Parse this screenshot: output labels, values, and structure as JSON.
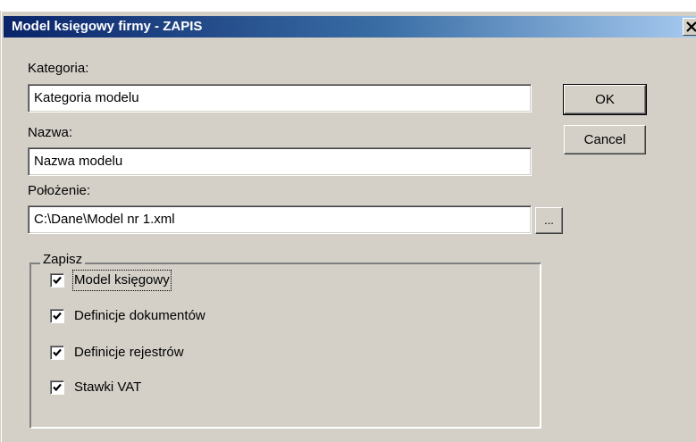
{
  "window": {
    "title": "Model księgowy firmy - ZAPIS",
    "close_symbol": "✕"
  },
  "form": {
    "kategoria_label": "Kategoria:",
    "kategoria_value": "Kategoria modelu",
    "nazwa_label": "Nazwa:",
    "nazwa_value": "Nazwa modelu",
    "polozenie_label": "Położenie:",
    "polozenie_value": "C:\\Dane\\Model nr 1.xml",
    "browse_label": "..."
  },
  "buttons": {
    "ok_label": "OK",
    "cancel_label": "Cancel"
  },
  "save_group": {
    "title": "Zapisz",
    "options": [
      {
        "label": "Model księgowy",
        "checked": true
      },
      {
        "label": "Definicje dokumentów",
        "checked": true
      },
      {
        "label": "Definicje rejestrów",
        "checked": true
      },
      {
        "label": "Stawki VAT",
        "checked": true
      }
    ]
  },
  "colors": {
    "titlebar_start": "#0a246a",
    "titlebar_end": "#a6caf0",
    "face": "#d4d0c8"
  }
}
